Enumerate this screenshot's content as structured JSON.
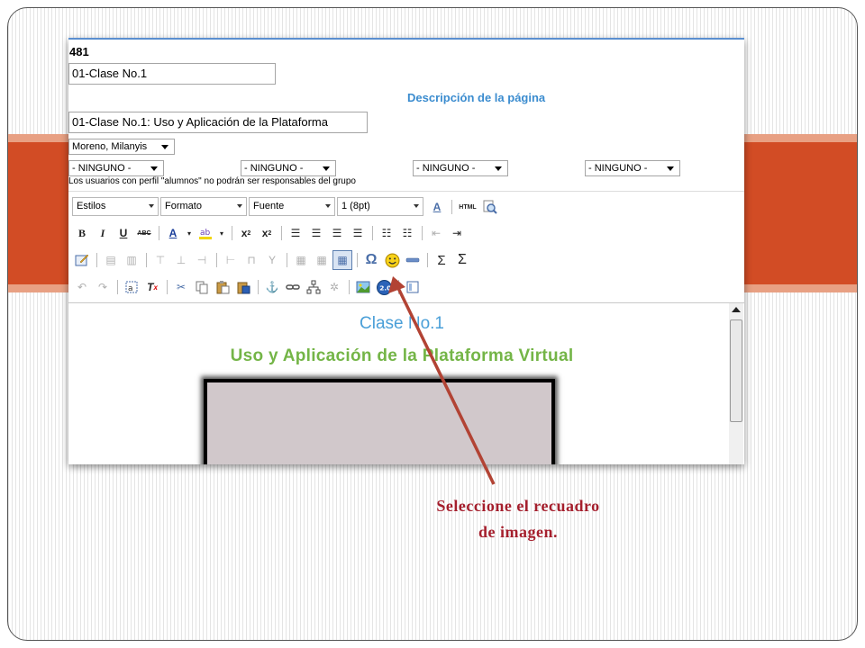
{
  "record_id": "481",
  "title_field": "01-Clase No.1",
  "description_label": "Descripción de la página",
  "description_field": "01-Clase No.1: Uso y Aplicación de la Plataforma",
  "responsible_select": "Moreno, Milanyis",
  "group_selects": [
    "- NINGUNO -",
    "- NINGUNO -",
    "- NINGUNO -",
    "- NINGUNO -"
  ],
  "note": "Los usuarios con perfil \"alumnos\" no podrán ser responsables del grupo",
  "toolbar": {
    "styles": "Estilos",
    "format": "Formato",
    "font": "Fuente",
    "size": "1 (8pt)",
    "bold": "B",
    "italic": "I",
    "underline": "U",
    "strike": "ABC",
    "text_color": "A",
    "omega": "Ω",
    "sigma": "Σ",
    "html": "HTML"
  },
  "editor": {
    "heading": "Clase No.1",
    "subheading": "Uso y Aplicación de la Plataforma Virtual"
  },
  "caption_line1": "Seleccione el recuadro",
  "caption_line2": "de imagen.",
  "colors": {
    "accent_orange": "#d24c25",
    "heading_blue": "#4a9fd8",
    "subheading_green": "#74b547",
    "caption_red": "#a51f2d",
    "arrow": "#b24334"
  }
}
